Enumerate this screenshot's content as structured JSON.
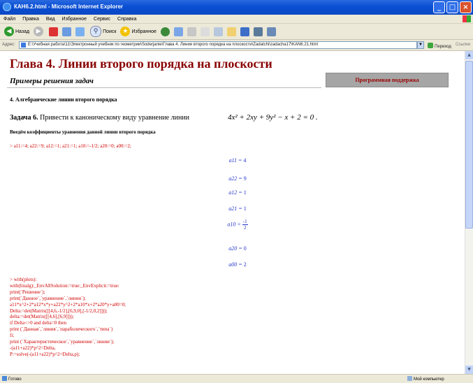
{
  "window": {
    "title": "КАН6.2.html - Microsoft Internet Explorer",
    "buttons": {
      "minimize": "_",
      "maximize": "□",
      "close": "×"
    }
  },
  "menu": {
    "items": [
      "Файл",
      "Правка",
      "Вид",
      "Избранное",
      "Сервис",
      "Справка"
    ]
  },
  "toolbar": {
    "back": "Назад",
    "search": "Поиск",
    "favorites": "Избранное"
  },
  "address": {
    "label": "Адрес:",
    "url": "E:\\Учебная работа\\11\\Электронный учебник по геометрии\\Soderjanie\\Глава 4. Линии второго порядка на плоскости\\Zadatchi\\zadacha17\\KAN6.21.html",
    "go": "Переход",
    "links": "Ссылки"
  },
  "page": {
    "chapter_title": "Глава 4. Линии второго порядка на плоскости",
    "subtitle": "Примеры решения задач",
    "support_button": "Программная поддержка",
    "section": "4. Алгебраические линии второго порядка",
    "task_label": "Задача 6.",
    "task_text": " Привести к каноническому виду уравнение линии",
    "equation": "4x² + 2xy + 9y² − x + 2 = 0 .",
    "intro": "Введём коэффициенты уравнения данной линии второго порядка",
    "command": "> a11:=4; a22:=9; a12:=1; a21:=1; a10:=-1/2; a20:=0; a00:=2;",
    "coefficients": [
      {
        "lhs": "a11",
        "rhs": "4"
      },
      {
        "lhs": "a22",
        "rhs": "9"
      },
      {
        "lhs": "a12",
        "rhs": "1"
      },
      {
        "lhs": "a21",
        "rhs": "1"
      },
      {
        "lhs": "a10",
        "num": "-1",
        "den": "2"
      },
      {
        "lhs": "a20",
        "rhs": "0"
      },
      {
        "lhs": "a00",
        "rhs": "2"
      }
    ],
    "code_lines": [
      "> with(plots):",
      "with(linalg):_EnvAllSolution:=true:_EnvExplicit:=true:",
      "print(`Решение`);",
      "print(`Данное`,`уравнение`,`линии`);",
      "a11*x^2+2*a12*x*y+a22*y^2+2*a10*x+2*a20*y+a00=0;",
      "Delta:=det(Matrix([[4,6,-1/2],[6,9,0],[-1/2,0,2]]));",
      "delta:=det(Matrix([[4,6],[6,9]]));",
      "if Delta<>0 and delta=0 then",
      "print (`Данная`,`линия`,`параболического`,`типа`)",
      "fi;",
      "print (`Характеристическое`,`уравнение`,`линии`);",
      "-(a11+a22)*p^2=Delta,",
      "P:=solve(-(a11+a22)*p^2=Delta,p);"
    ]
  },
  "status": {
    "left": "Готово",
    "right": "Мой компьютер"
  }
}
